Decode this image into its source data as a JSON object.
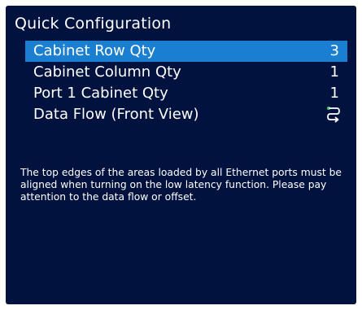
{
  "title": "Quick Configuration",
  "menu": {
    "items": [
      {
        "label": "Cabinet Row Qty",
        "value": "3"
      },
      {
        "label": "Cabinet Column Qty",
        "value": "1"
      },
      {
        "label": "Port 1 Cabinet Qty",
        "value": "1"
      },
      {
        "label": "Data Flow (Front View)",
        "icon": "data-flow-icon"
      }
    ],
    "selected_index": 0
  },
  "info": {
    "text": "The top edges of the areas loaded by all Ethernet ports must be aligned when turning on the low latency function. Please pay attention to the data flow or offset."
  },
  "colors": {
    "background": "#02123f",
    "highlight": "#1a7fd0",
    "text": "#ffffff",
    "icon_dot": "#2fd06a"
  }
}
